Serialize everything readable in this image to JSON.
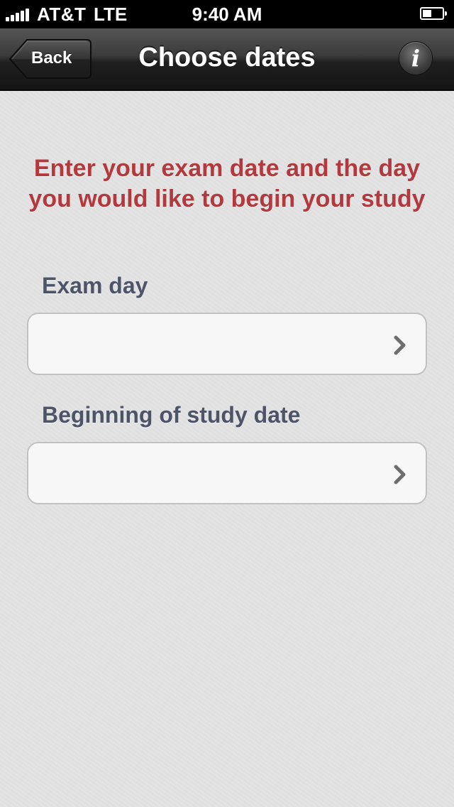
{
  "status_bar": {
    "carrier": "AT&T",
    "network": "LTE",
    "time": "9:40 AM"
  },
  "nav": {
    "back_label": "Back",
    "title": "Choose dates",
    "info_icon": "info-icon"
  },
  "instruction": {
    "line1": "Enter your exam date and the day",
    "line2": "you would like to begin your study"
  },
  "fields": [
    {
      "label": "Exam day",
      "value": ""
    },
    {
      "label": "Beginning of study date",
      "value": ""
    }
  ],
  "colors": {
    "instruction_text": "#b23a3e",
    "label_text": "#4e5468",
    "nav_bar": "#2a2a2a"
  }
}
